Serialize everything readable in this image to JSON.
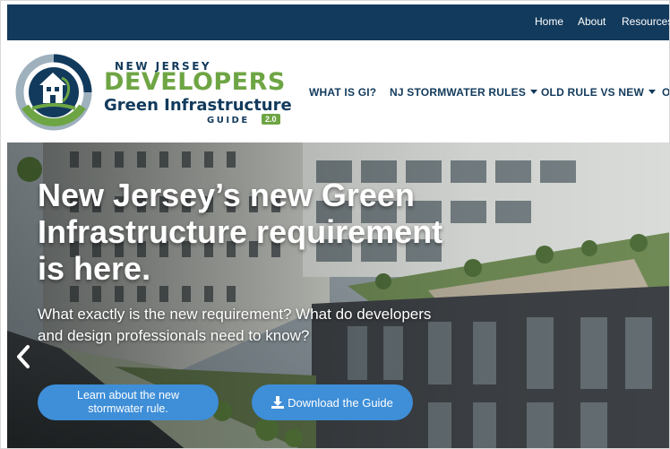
{
  "topbar": {
    "links": [
      "Home",
      "About",
      "Resources"
    ]
  },
  "brand": {
    "line1": "NEW JERSEY",
    "line2": "DEVELOPERS",
    "line3": "Green Infrastructure",
    "line4": "GUIDE",
    "version": "2.0",
    "colors": {
      "navy": "#123a5c",
      "green": "#6ea544"
    }
  },
  "nav": {
    "items": [
      {
        "label": "WHAT IS GI?",
        "dropdown": false
      },
      {
        "label": "NJ STORMWATER RULES",
        "dropdown": true
      },
      {
        "label": "OLD RULE VS NEW",
        "dropdown": true
      },
      {
        "label": "O",
        "dropdown": false
      }
    ]
  },
  "hero": {
    "headline": "New Jersey’s new Green Infrastructure requirement is here.",
    "subline": "What exactly is the new requirement? What do developers and design professionals need to know?",
    "button_learn": "Learn about the new stormwater rule.",
    "button_download": "Download the Guide",
    "prev_icon": "chevron-left-icon",
    "download_icon": "download-icon",
    "button_color": "#3e8ed8"
  }
}
